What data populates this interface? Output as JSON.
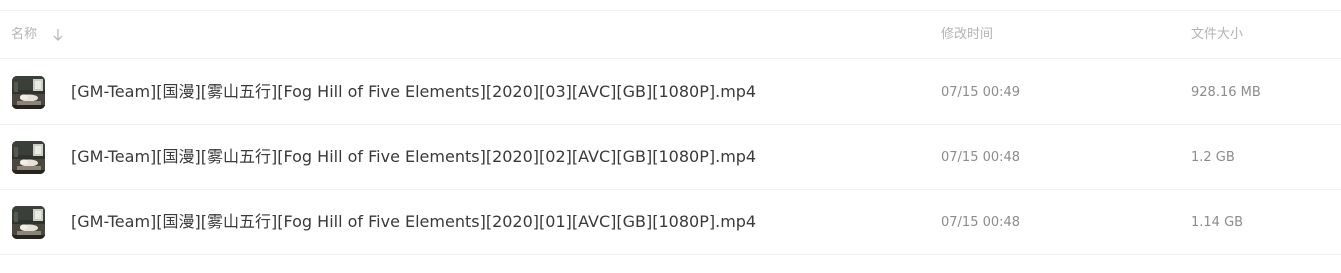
{
  "header": {
    "name_label": "名称",
    "sort_icon": "arrow-down-icon",
    "modified_label": "修改时间",
    "size_label": "文件大小"
  },
  "files": [
    {
      "name": "[GM-Team][国漫][雾山五行][Fog Hill of Five Elements][2020][03][AVC][GB][1080P].mp4",
      "modified": "07/15 00:49",
      "size": "928.16 MB",
      "thumbnail_icon": "video-thumbnail-icon"
    },
    {
      "name": "[GM-Team][国漫][雾山五行][Fog Hill of Five Elements][2020][02][AVC][GB][1080P].mp4",
      "modified": "07/15 00:48",
      "size": "1.2 GB",
      "thumbnail_icon": "video-thumbnail-icon"
    },
    {
      "name": "[GM-Team][国漫][雾山五行][Fog Hill of Five Elements][2020][01][AVC][GB][1080P].mp4",
      "modified": "07/15 00:48",
      "size": "1.14 GB",
      "thumbnail_icon": "video-thumbnail-icon"
    }
  ],
  "colors": {
    "header_text": "#b3b3b3",
    "file_name_text": "#3a3a3a",
    "meta_text": "#8c8c8c",
    "divider": "#eeeeee"
  }
}
